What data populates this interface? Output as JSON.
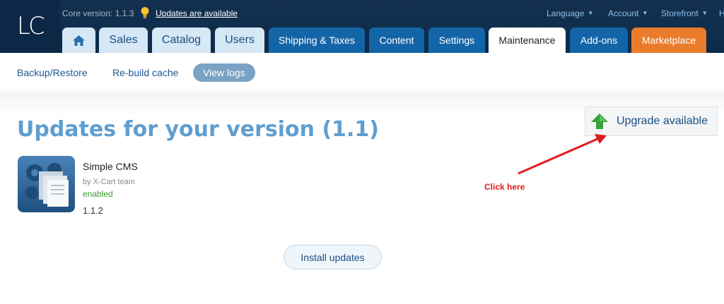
{
  "header": {
    "logo": "LC",
    "core_version": "Core version: 1.1.3",
    "updates_link": "Updates are available",
    "language": "Language",
    "account": "Account",
    "storefront": "Storefront",
    "help_partial": "H"
  },
  "tabs": [
    {
      "label": "home-icon"
    },
    {
      "label": "Sales"
    },
    {
      "label": "Catalog"
    },
    {
      "label": "Users"
    },
    {
      "label": "Shipping & Taxes"
    },
    {
      "label": "Content"
    },
    {
      "label": "Settings"
    },
    {
      "label": "Maintenance"
    },
    {
      "label": "Add-ons"
    },
    {
      "label": "Marketplace"
    }
  ],
  "subnav": {
    "backup": "Backup/Restore",
    "rebuild": "Re-build cache",
    "logs": "View logs"
  },
  "main": {
    "heading": "Updates for your version (1.1)",
    "upgrade_button": "Upgrade available",
    "annotation": "Click here",
    "install_button": "Install updates"
  },
  "module": {
    "name": "Simple CMS",
    "author": "by X-Cart team",
    "status": "enabled",
    "version": "1.1.2"
  },
  "colors": {
    "header_bg": "#0d2b4a",
    "tab_light": "#d6e7f6",
    "tab_dark": "#1465a8",
    "tab_orange": "#ea7b2b",
    "heading": "#5f9ed0",
    "annotation": "#e01b1b",
    "status": "#3a9a2e"
  }
}
